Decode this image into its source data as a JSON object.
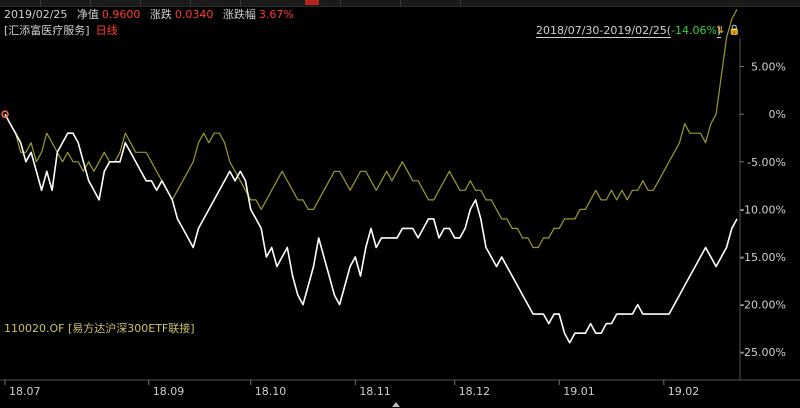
{
  "header": {
    "date": "2019/02/25",
    "nav_label": "净值",
    "nav_value": "0.9600",
    "change_label": "涨跌",
    "change_value": "0.0340",
    "pct_label": "涨跌幅",
    "pct_value": "3.67%"
  },
  "fund": {
    "name": "[汇添富医疗服务]",
    "period": "日线"
  },
  "range": {
    "dates": "2018/07/30-2019/02/25",
    "pct_open": "(",
    "pct": "-14.06%",
    "pct_close": ")"
  },
  "icons": [
    "sort-icon",
    "lock-icon"
  ],
  "compare": {
    "label": "110020.OF [易方达沪深300ETF联接]"
  },
  "colors": {
    "fund_line": "#ffffff",
    "compare_line": "#9a9a2a",
    "grid": "#2e2e2e",
    "positive": "#3ecf3e",
    "negative": "#ff3b30"
  },
  "chart_data": {
    "type": "line",
    "x_tick_labels": [
      "18.07",
      "18.09",
      "18.10",
      "18.11",
      "18.12",
      "19.01",
      "19.02"
    ],
    "y_tick_labels": [
      "5.00%",
      "0%",
      "-5.00%",
      "-10.00%",
      "-15.00%",
      "-20.00%",
      "-25.00%"
    ],
    "ylim": [
      -27.5,
      8
    ],
    "x_index_range": [
      0,
      140
    ],
    "x_tick_index": [
      0,
      27.5,
      47,
      67,
      86,
      106,
      126
    ],
    "grid": false,
    "series": [
      {
        "name": "[汇添富医疗服务]",
        "values": [
          0,
          -1,
          -2,
          -3,
          -5,
          -4,
          -6,
          -8,
          -6,
          -8,
          -4,
          -3,
          -2,
          -2,
          -3,
          -5,
          -7,
          -8,
          -9,
          -6,
          -5,
          -5,
          -5,
          -3,
          -4,
          -5,
          -6,
          -7,
          -7,
          -8,
          -7,
          -8,
          -9,
          -11,
          -12,
          -13,
          -14,
          -12,
          -11,
          -10,
          -9,
          -8,
          -7,
          -6,
          -7,
          -6,
          -7,
          -10,
          -11,
          -12,
          -15,
          -14,
          -16,
          -15,
          -14,
          -17,
          -19,
          -20,
          -18,
          -16,
          -13,
          -15,
          -17,
          -19,
          -20,
          -18,
          -16,
          -15,
          -17,
          -14,
          -12,
          -14,
          -13,
          -13,
          -13,
          -13,
          -12,
          -12,
          -12,
          -13,
          -12,
          -11,
          -11,
          -13,
          -12,
          -12,
          -13,
          -13,
          -12,
          -10,
          -9,
          -11,
          -14,
          -15,
          -16,
          -15,
          -16,
          -17,
          -18,
          -19,
          -20,
          -21,
          -21,
          -21,
          -22,
          -21,
          -21,
          -23,
          -24,
          -23,
          -23,
          -23,
          -22,
          -23,
          -23,
          -22,
          -22,
          -21,
          -21,
          -21,
          -21,
          -20,
          -21,
          -21,
          -21,
          -21,
          -21,
          -21,
          -20,
          -19,
          -18,
          -17,
          -16,
          -15,
          -14,
          -15,
          -16,
          -15,
          -14,
          -12,
          -11
        ]
      },
      {
        "name": "110020.OF [易方达沪深300ETF联接]",
        "values": [
          0,
          -1,
          -2,
          -4,
          -4,
          -3,
          -5,
          -4,
          -2,
          -3,
          -4,
          -5,
          -4,
          -5,
          -5,
          -6,
          -5,
          -6,
          -5,
          -4,
          -5,
          -5,
          -4,
          -2,
          -3,
          -4,
          -4,
          -4,
          -5,
          -6,
          -7,
          -8,
          -9,
          -8,
          -7,
          -6,
          -5,
          -3,
          -2,
          -3,
          -2,
          -2,
          -3,
          -5,
          -6,
          -7,
          -8,
          -9,
          -9,
          -10,
          -9,
          -8,
          -7,
          -6,
          -7,
          -8,
          -9,
          -9,
          -10,
          -10,
          -9,
          -8,
          -7,
          -6,
          -6,
          -7,
          -8,
          -7,
          -6,
          -6,
          -7,
          -8,
          -7,
          -6,
          -7,
          -6,
          -5,
          -6,
          -7,
          -7,
          -8,
          -9,
          -9,
          -8,
          -7,
          -6,
          -7,
          -8,
          -8,
          -7,
          -8,
          -8,
          -9,
          -9,
          -10,
          -11,
          -11,
          -12,
          -12,
          -13,
          -13,
          -14,
          -14,
          -13,
          -13,
          -12,
          -12,
          -11,
          -11,
          -11,
          -10,
          -10,
          -9,
          -8,
          -9,
          -9,
          -8,
          -9,
          -8,
          -9,
          -8,
          -8,
          -7,
          -8,
          -8,
          -7,
          -6,
          -5,
          -4,
          -3,
          -1,
          -2,
          -2,
          -2,
          -3,
          -1,
          0,
          4,
          8,
          10,
          11
        ]
      }
    ]
  }
}
